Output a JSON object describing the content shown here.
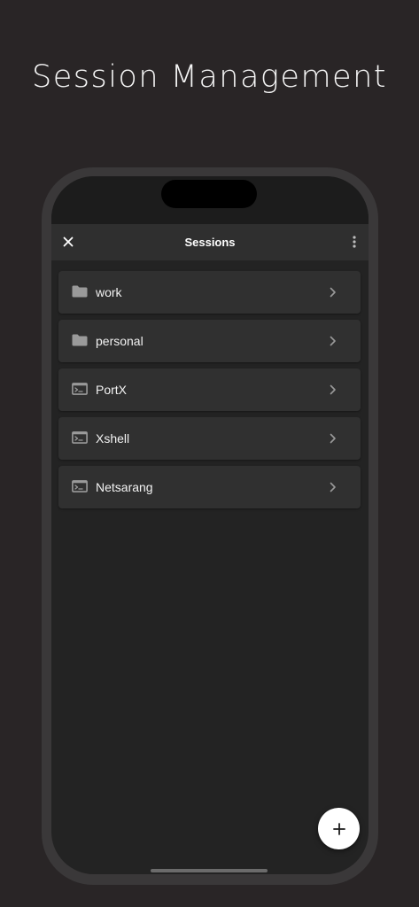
{
  "promo": {
    "title": "Session Management"
  },
  "app_bar": {
    "title": "Sessions",
    "close_icon": "close-icon",
    "menu_icon": "more-vertical-icon"
  },
  "sessions": [
    {
      "label": "work",
      "type": "folder",
      "icon": "folder-icon"
    },
    {
      "label": "personal",
      "type": "folder",
      "icon": "folder-icon"
    },
    {
      "label": "PortX",
      "type": "terminal",
      "icon": "terminal-icon"
    },
    {
      "label": "Xshell",
      "type": "terminal",
      "icon": "terminal-icon"
    },
    {
      "label": "Netsarang",
      "type": "terminal",
      "icon": "terminal-icon"
    }
  ],
  "fab": {
    "icon": "plus-icon"
  },
  "colors": {
    "background": "#292526",
    "screen": "#232323",
    "app_bar": "#2f2f2f",
    "list_item": "#303030",
    "icon_gray": "#9a9a9a",
    "fab": "#ffffff"
  }
}
